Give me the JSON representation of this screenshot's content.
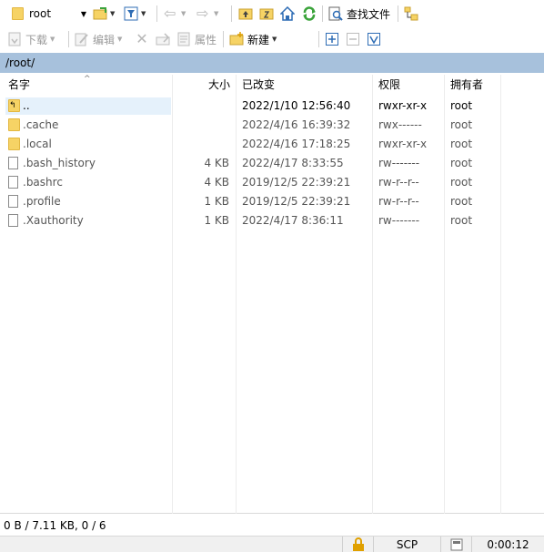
{
  "toolbar1": {
    "location": "root",
    "find_files_label": "查找文件"
  },
  "toolbar2": {
    "download_label": "下载",
    "edit_label": "编辑",
    "properties_label": "属性",
    "new_label": "新建"
  },
  "path": "/root/",
  "columns": {
    "name": "名字",
    "size": "大小",
    "modified": "已改变",
    "rights": "权限",
    "owner": "拥有者"
  },
  "files": [
    {
      "name": "..",
      "size": "",
      "modified": "2022/1/10 12:56:40",
      "rights": "rwxr-xr-x",
      "owner": "root",
      "icon": "parent-folder-icon"
    },
    {
      "name": ".cache",
      "size": "",
      "modified": "2022/4/16 16:39:32",
      "rights": "rwx------",
      "owner": "root",
      "icon": "folder-icon"
    },
    {
      "name": ".local",
      "size": "",
      "modified": "2022/4/16 17:18:25",
      "rights": "rwxr-xr-x",
      "owner": "root",
      "icon": "folder-icon"
    },
    {
      "name": ".bash_history",
      "size": "4 KB",
      "modified": "2022/4/17 8:33:55",
      "rights": "rw-------",
      "owner": "root",
      "icon": "file-icon"
    },
    {
      "name": ".bashrc",
      "size": "4 KB",
      "modified": "2019/12/5 22:39:21",
      "rights": "rw-r--r--",
      "owner": "root",
      "icon": "file-icon"
    },
    {
      "name": ".profile",
      "size": "1 KB",
      "modified": "2019/12/5 22:39:21",
      "rights": "rw-r--r--",
      "owner": "root",
      "icon": "file-icon"
    },
    {
      "name": ".Xauthority",
      "size": "1 KB",
      "modified": "2022/4/17 8:36:11",
      "rights": "rw-------",
      "owner": "root",
      "icon": "file-icon"
    }
  ],
  "status": {
    "selection": "0 B / 7.11 KB,   0 / 6",
    "protocol": "SCP",
    "elapsed": "0:00:12"
  },
  "colors": {
    "path_bar": "#a7c1dc",
    "folder": "#f6d365",
    "green_refresh": "#3aa33a",
    "blue_home": "#2f6db5"
  }
}
